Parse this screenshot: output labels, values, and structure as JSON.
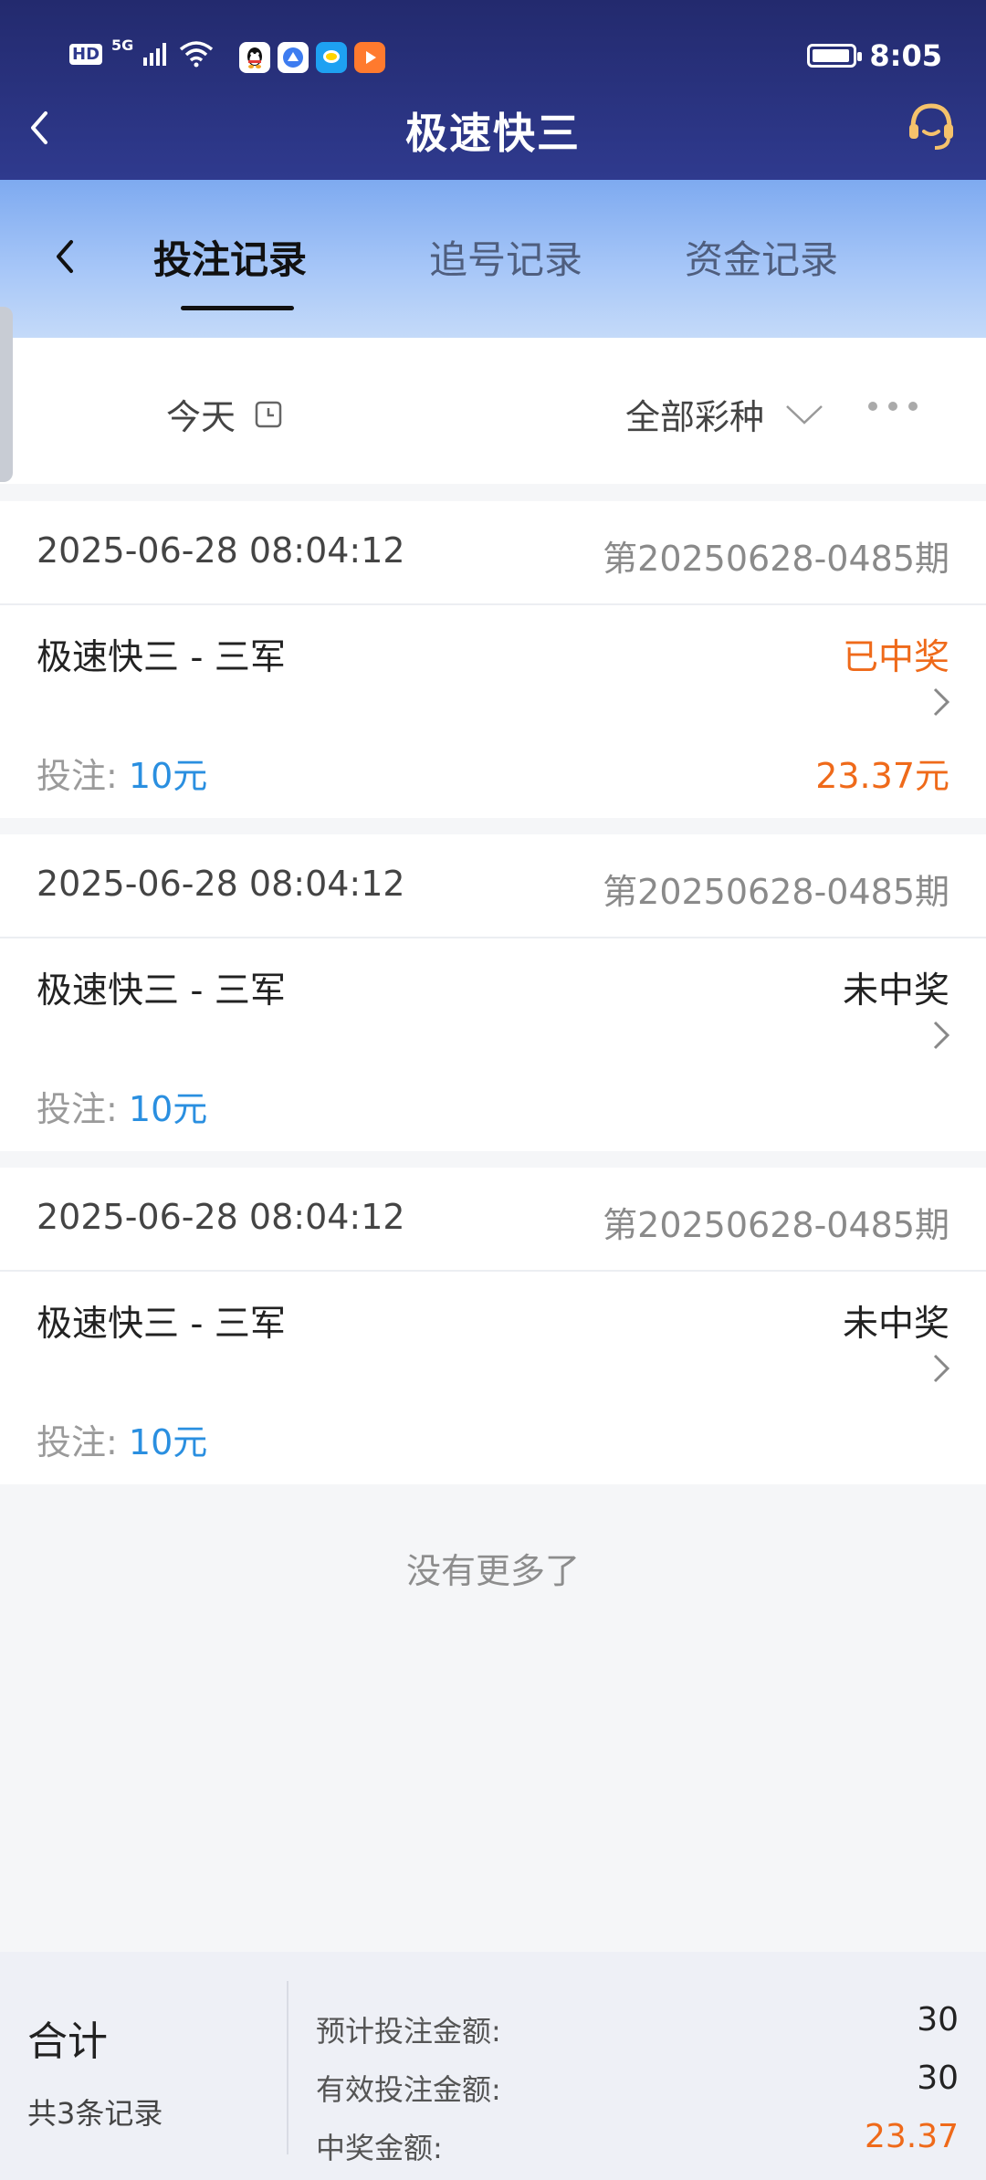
{
  "status_bar": {
    "network": "HD",
    "signal": "5G",
    "time": "8:05",
    "battery_level": 0.95
  },
  "header": {
    "title": "极速快三"
  },
  "tabs": [
    {
      "label": "投注记录",
      "active": true
    },
    {
      "label": "追号记录",
      "active": false
    },
    {
      "label": "资金记录",
      "active": false
    }
  ],
  "filter": {
    "date_label": "今天",
    "lottery_label": "全部彩种"
  },
  "records": [
    {
      "time": "2025-06-28 08:04:12",
      "period": "第20250628-0485期",
      "name": "极速快三 - 三军",
      "status": "已中奖",
      "bet_label": "投注: ",
      "bet_amount": "10元",
      "prize": "23.37元"
    },
    {
      "time": "2025-06-28 08:04:12",
      "period": "第20250628-0485期",
      "name": "极速快三 - 三军",
      "status": "未中奖",
      "bet_label": "投注: ",
      "bet_amount": "10元",
      "prize": ""
    },
    {
      "time": "2025-06-28 08:04:12",
      "period": "第20250628-0485期",
      "name": "极速快三 - 三军",
      "status": "未中奖",
      "bet_label": "投注: ",
      "bet_amount": "10元",
      "prize": ""
    }
  ],
  "no_more_text": "没有更多了",
  "summary": {
    "title": "合计",
    "count": "共3条记录",
    "expected_label": "预计投注金额:",
    "expected_value": "30",
    "effective_label": "有效投注金额:",
    "effective_value": "30",
    "prize_label": "中奖金额:",
    "prize_value": "23.37"
  },
  "colors": {
    "header_bg": "#2f3a8e",
    "accent_orange": "#ef6a1a",
    "accent_blue": "#2a8fe0"
  }
}
